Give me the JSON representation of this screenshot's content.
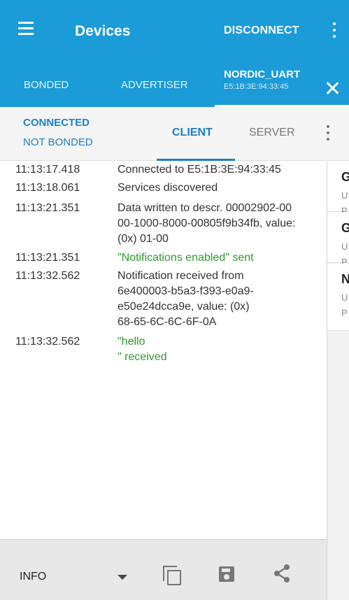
{
  "appbar": {
    "title": "Devices",
    "disconnect_label": "DISCONNECT",
    "menu_icon": "hamburger-icon",
    "overflow_icon": "more-vert-icon"
  },
  "device_tabs": {
    "bonded": "BONDED",
    "advertiser": "ADVERTISER",
    "active_name": "NORDIC_UART",
    "active_address": "E5:1B:3E:94:33:45",
    "close_icon": "close-icon"
  },
  "subbar": {
    "connection_status": "CONNECTED",
    "bond_status": "NOT BONDED",
    "tab_client": "CLIENT",
    "tab_server": "SERVER",
    "overflow_icon": "more-vert-icon"
  },
  "log": [
    {
      "time": "11:13:17.418",
      "message": "Connected to E5:1B:3E:94:33:45",
      "color": "#333333"
    },
    {
      "time": "11:13:18.061",
      "message": "Services discovered",
      "color": "#333333"
    },
    {
      "time": "11:13:21.351",
      "message": "Data written to descr. 00002902-00\n00-1000-8000-00805f9b34fb, value:\n(0x) 01-00",
      "color": "#333333"
    },
    {
      "time": "11:13:21.351",
      "message": "\"Notifications enabled\" sent",
      "color": "#2e9a2e"
    },
    {
      "time": "11:13:32.562",
      "message": "Notification received from\n6e400003-b5a3-f393-e0a9-\ne50e24dcca9e, value: (0x)\n68-65-6C-6C-6F-0A",
      "color": "#333333"
    },
    {
      "time": "11:13:32.562",
      "message": "\"hello\n\" received",
      "color": "#2e9a2e"
    }
  ],
  "services_panel": [
    {
      "title": "G",
      "line1": "U",
      "line2": "P"
    },
    {
      "title": "G",
      "line1": "U",
      "line2": "P"
    },
    {
      "title": "N",
      "line1": "U",
      "line2": "P"
    }
  ],
  "bottombar": {
    "level": "INFO",
    "copy_icon": "copy-icon",
    "save_icon": "save-icon",
    "share_icon": "share-icon"
  },
  "colors": {
    "primary": "#1b9bd8",
    "accent": "#1b80c4",
    "log_green": "#2e9a2e"
  }
}
